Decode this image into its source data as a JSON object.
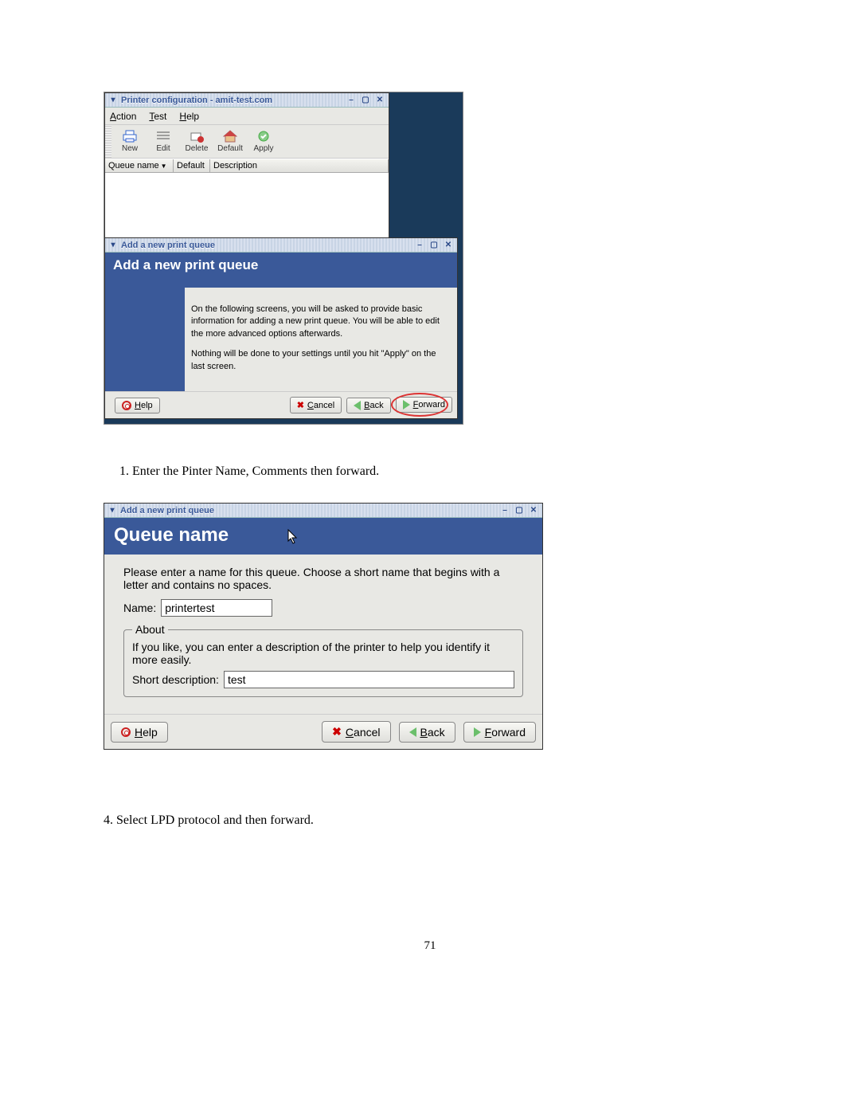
{
  "printer_config": {
    "title": "Printer configuration - amit-test.com",
    "menu": {
      "action": "Action",
      "test": "Test",
      "help": "Help"
    },
    "toolbar": {
      "new": "New",
      "edit": "Edit",
      "delete": "Delete",
      "default": "Default",
      "apply": "Apply"
    },
    "cols": {
      "queue": "Queue name",
      "default": "Default",
      "description": "Description"
    }
  },
  "addq1": {
    "win_title": "Add a new print queue",
    "banner": "Add a new print queue",
    "p1": "On the following screens, you will be asked to provide basic information for adding a new print queue.  You will be able to edit the more advanced options afterwards.",
    "p2": "Nothing will be done to your settings until you hit \"Apply\" on the last screen.",
    "help": "Help",
    "cancel": "Cancel",
    "back": "Back",
    "forward": "Forward"
  },
  "step1_text": "1. Enter the Pinter Name, Comments then forward.",
  "addq2": {
    "win_title": "Add a new print queue",
    "banner": "Queue name",
    "intro": "Please enter a name for this queue.  Choose a short name that begins with a letter and contains no spaces.",
    "name_label": "Name:",
    "name_value": "printertest",
    "about_legend": "About",
    "about_text": "If you like, you can enter a description of the printer to help you identify it more easily.",
    "desc_label": "Short description:",
    "desc_value": "test",
    "help": "Help",
    "cancel": "Cancel",
    "back": "Back",
    "forward": "Forward"
  },
  "step4_text": "4. Select LPD protocol and then forward.",
  "page_num": "71"
}
